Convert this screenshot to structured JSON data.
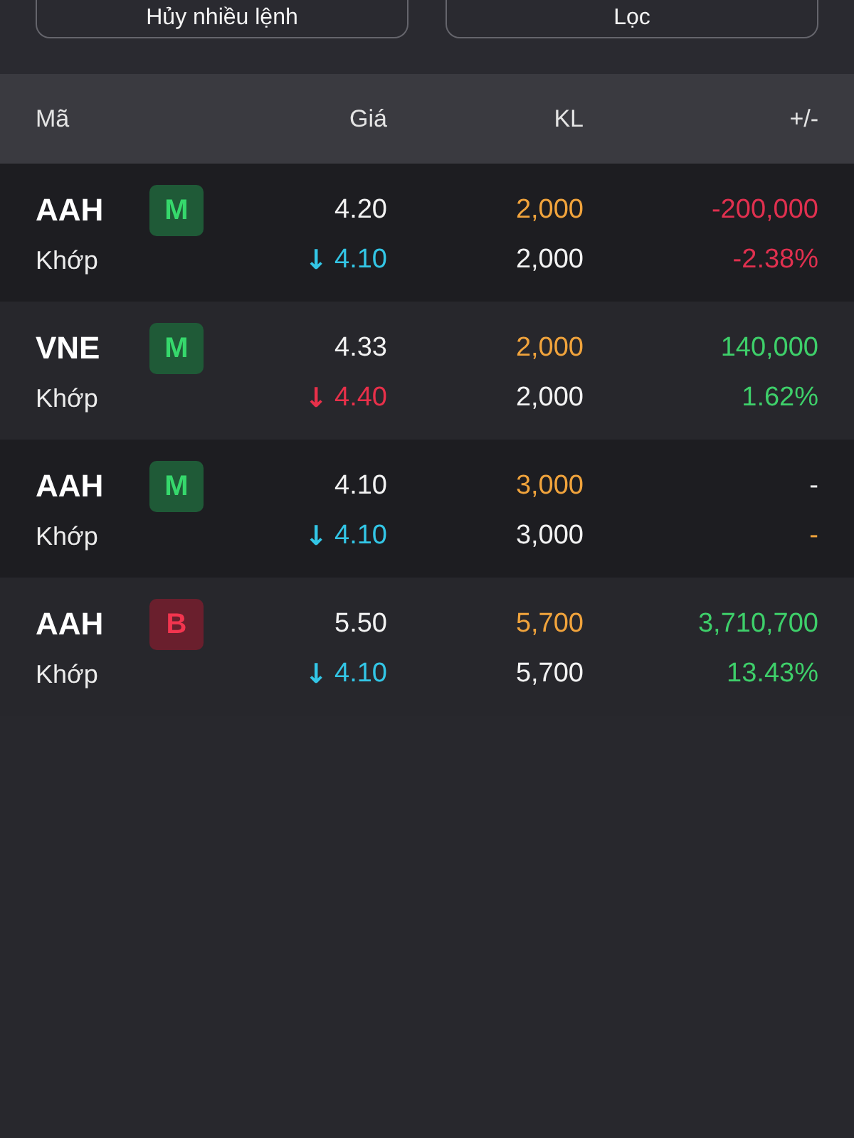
{
  "action_buttons": [
    {
      "label": "Hủy nhiều lệnh"
    },
    {
      "label": "Lọc"
    }
  ],
  "table": {
    "columns": [
      "Mã",
      "Giá",
      "KL",
      "+/-"
    ],
    "rows": [
      {
        "symbol": "AAH",
        "side": {
          "label": "M",
          "kind": "buy"
        },
        "status": "Khớp",
        "price": "4.20",
        "match": {
          "arrow": "↓",
          "price": "4.10",
          "color": "#33c6e6"
        },
        "volume": "2,000",
        "matched_volume": "2,000",
        "change": {
          "text": "-200,000",
          "color": "#e0304f"
        },
        "change_percent": {
          "text": "-2.38%",
          "color": "#e0304f"
        }
      },
      {
        "symbol": "VNE",
        "side": {
          "label": "M",
          "kind": "buy"
        },
        "status": "Khớp",
        "price": "4.33",
        "match": {
          "arrow": "↓",
          "price": "4.40",
          "color": "#e8304a"
        },
        "volume": "2,000",
        "matched_volume": "2,000",
        "change": {
          "text": "140,000",
          "color": "#3ecf6a"
        },
        "change_percent": {
          "text": "1.62%",
          "color": "#3ecf6a"
        }
      },
      {
        "symbol": "AAH",
        "side": {
          "label": "M",
          "kind": "buy"
        },
        "status": "Khớp",
        "price": "4.10",
        "match": {
          "arrow": "↓",
          "price": "4.10",
          "color": "#33c6e6"
        },
        "volume": "3,000",
        "matched_volume": "3,000",
        "change": {
          "text": "-",
          "color": "#ececec"
        },
        "change_percent": {
          "text": "-",
          "color": "#f0a33c"
        }
      },
      {
        "symbol": "AAH",
        "side": {
          "label": "B",
          "kind": "sell"
        },
        "status": "Khớp",
        "price": "5.50",
        "match": {
          "arrow": "↓",
          "price": "4.10",
          "color": "#33c6e6"
        },
        "volume": "5,700",
        "matched_volume": "5,700",
        "change": {
          "text": "3,710,700",
          "color": "#3ecf6a"
        },
        "change_percent": {
          "text": "13.43%",
          "color": "#3ecf6a"
        }
      }
    ]
  }
}
